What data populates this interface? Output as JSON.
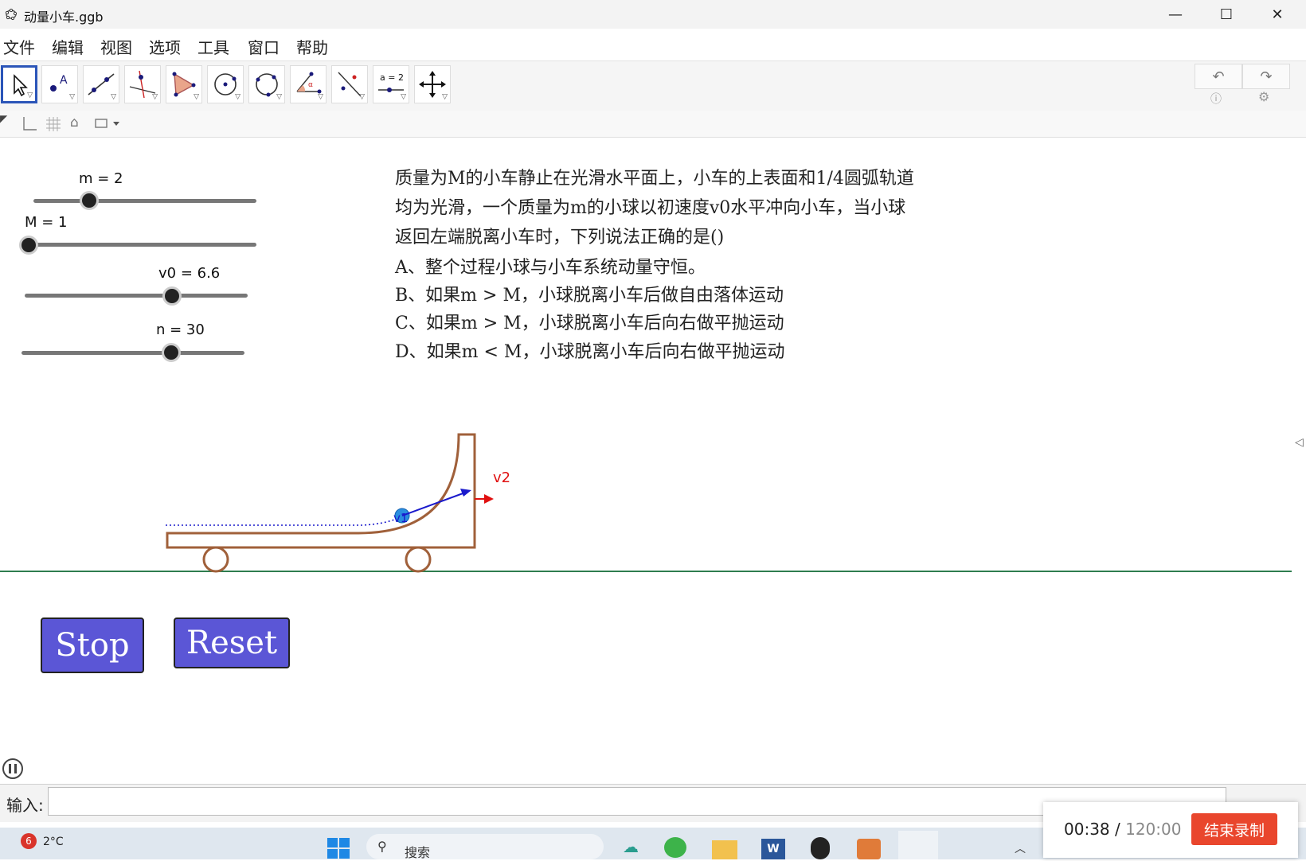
{
  "window": {
    "title": "动量小车.ggb",
    "minimize": "—",
    "maximize": "☐",
    "close": "✕"
  },
  "menu": [
    "文件",
    "编辑",
    "视图",
    "选项",
    "工具",
    "窗口",
    "帮助"
  ],
  "toolbar": {
    "tools": [
      "move-tool",
      "point-tool",
      "line-tool",
      "perpendicular-tool",
      "polygon-tool",
      "circle-center-tool",
      "circle-three-points-tool",
      "angle-tool",
      "reflect-tool",
      "slider-tool",
      "move-view-tool"
    ],
    "slider_tool_label": "a = 2",
    "undo": "↶",
    "redo": "↷"
  },
  "sliders": [
    {
      "label": "m = 2",
      "fraction": 0.25
    },
    {
      "label": "M = 1",
      "fraction": 0.0
    },
    {
      "label": "v0 = 6.6",
      "fraction": 0.66
    },
    {
      "label": "n = 30",
      "fraction": 0.67
    }
  ],
  "question": {
    "line1": "质量为M的小车静止在光滑水平面上，小车的上表面和1/4圆弧轨道",
    "line2": "均为光滑，一个质量为m的小球以初速度v0水平冲向小车，当小球",
    "line3": "返回左端脱离小车时，下列说法正确的是()",
    "optionA": "A、整个过程小球与小车系统动量守恒。",
    "optionB": "B、如果m > M，小球脱离小车后做自由落体运动",
    "optionC": "C、如果m > M，小球脱离小车后向右做平抛运动",
    "optionD": "D、如果m < M，小球脱离小车后向右做平抛运动"
  },
  "diagram": {
    "v1_label": "v1",
    "v2_label": "v2"
  },
  "buttons": {
    "stop": "Stop",
    "reset": "Reset"
  },
  "input_bar": {
    "label": "输入:"
  },
  "taskbar": {
    "weather_badge": "6",
    "temperature": "2°C",
    "search_placeholder": "搜索"
  },
  "recorder": {
    "elapsed": "00:38",
    "separator": " / ",
    "total": "120:00",
    "stop_label": "结束录制"
  },
  "colors": {
    "button_fill": "#5b56d6",
    "cart_brown": "#a0603a",
    "ground_green": "#2e7d4f",
    "velocity_blue": "#1a1acc",
    "velocity_red": "#e01010",
    "record_red": "#e9462d"
  }
}
